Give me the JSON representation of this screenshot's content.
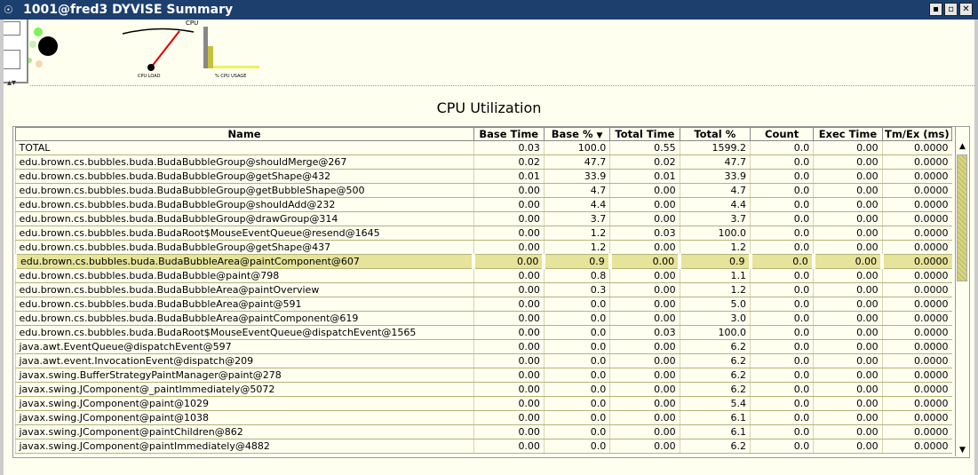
{
  "window": {
    "title": "1001@fred3 DYVISE Summary",
    "buttons": [
      "▪",
      "▫",
      "✕"
    ]
  },
  "gauges": {
    "cpu_label": "CPU",
    "cpu_load_label": "CPU LOAD",
    "cpu_usage_label": "% CPU USAGE"
  },
  "panel": {
    "title": "CPU Utilization"
  },
  "table": {
    "columns": [
      "Name",
      "Base Time",
      "Base %",
      "Total Time",
      "Total %",
      "Count",
      "Exec Time",
      "Tm/Ex (ms)"
    ],
    "sort_indicator": "▼",
    "selected_row": 8,
    "rows": [
      [
        "TOTAL",
        "0.03",
        "100.0",
        "0.55",
        "1599.2",
        "0.0",
        "0.00",
        "0.0000"
      ],
      [
        "edu.brown.cs.bubbles.buda.BudaBubbleGroup@shouldMerge@267",
        "0.02",
        "47.7",
        "0.02",
        "47.7",
        "0.0",
        "0.00",
        "0.0000"
      ],
      [
        "edu.brown.cs.bubbles.buda.BudaBubbleGroup@getShape@432",
        "0.01",
        "33.9",
        "0.01",
        "33.9",
        "0.0",
        "0.00",
        "0.0000"
      ],
      [
        "edu.brown.cs.bubbles.buda.BudaBubbleGroup@getBubbleShape@500",
        "0.00",
        "4.7",
        "0.00",
        "4.7",
        "0.0",
        "0.00",
        "0.0000"
      ],
      [
        "edu.brown.cs.bubbles.buda.BudaBubbleGroup@shouldAdd@232",
        "0.00",
        "4.4",
        "0.00",
        "4.4",
        "0.0",
        "0.00",
        "0.0000"
      ],
      [
        "edu.brown.cs.bubbles.buda.BudaBubbleGroup@drawGroup@314",
        "0.00",
        "3.7",
        "0.00",
        "3.7",
        "0.0",
        "0.00",
        "0.0000"
      ],
      [
        "edu.brown.cs.bubbles.buda.BudaRoot$MouseEventQueue@resend@1645",
        "0.00",
        "1.2",
        "0.03",
        "100.0",
        "0.0",
        "0.00",
        "0.0000"
      ],
      [
        "edu.brown.cs.bubbles.buda.BudaBubbleGroup@getShape@437",
        "0.00",
        "1.2",
        "0.00",
        "1.2",
        "0.0",
        "0.00",
        "0.0000"
      ],
      [
        "edu.brown.cs.bubbles.buda.BudaBubbleArea@paintComponent@607",
        "0.00",
        "0.9",
        "0.00",
        "0.9",
        "0.0",
        "0.00",
        "0.0000"
      ],
      [
        "edu.brown.cs.bubbles.buda.BudaBubble@paint@798",
        "0.00",
        "0.8",
        "0.00",
        "1.1",
        "0.0",
        "0.00",
        "0.0000"
      ],
      [
        "edu.brown.cs.bubbles.buda.BudaBubbleArea@paintOverview",
        "0.00",
        "0.3",
        "0.00",
        "1.2",
        "0.0",
        "0.00",
        "0.0000"
      ],
      [
        "edu.brown.cs.bubbles.buda.BudaBubbleArea@paint@591",
        "0.00",
        "0.0",
        "0.00",
        "5.0",
        "0.0",
        "0.00",
        "0.0000"
      ],
      [
        "edu.brown.cs.bubbles.buda.BudaBubbleArea@paintComponent@619",
        "0.00",
        "0.0",
        "0.00",
        "3.0",
        "0.0",
        "0.00",
        "0.0000"
      ],
      [
        "edu.brown.cs.bubbles.buda.BudaRoot$MouseEventQueue@dispatchEvent@1565",
        "0.00",
        "0.0",
        "0.03",
        "100.0",
        "0.0",
        "0.00",
        "0.0000"
      ],
      [
        "java.awt.EventQueue@dispatchEvent@597",
        "0.00",
        "0.0",
        "0.00",
        "6.2",
        "0.0",
        "0.00",
        "0.0000"
      ],
      [
        "java.awt.event.InvocationEvent@dispatch@209",
        "0.00",
        "0.0",
        "0.00",
        "6.2",
        "0.0",
        "0.00",
        "0.0000"
      ],
      [
        "javax.swing.BufferStrategyPaintManager@paint@278",
        "0.00",
        "0.0",
        "0.00",
        "6.2",
        "0.0",
        "0.00",
        "0.0000"
      ],
      [
        "javax.swing.JComponent@_paintImmediately@5072",
        "0.00",
        "0.0",
        "0.00",
        "6.2",
        "0.0",
        "0.00",
        "0.0000"
      ],
      [
        "javax.swing.JComponent@paint@1029",
        "0.00",
        "0.0",
        "0.00",
        "5.4",
        "0.0",
        "0.00",
        "0.0000"
      ],
      [
        "javax.swing.JComponent@paint@1038",
        "0.00",
        "0.0",
        "0.00",
        "6.1",
        "0.0",
        "0.00",
        "0.0000"
      ],
      [
        "javax.swing.JComponent@paintChildren@862",
        "0.00",
        "0.0",
        "0.00",
        "6.1",
        "0.0",
        "0.00",
        "0.0000"
      ],
      [
        "javax.swing.JComponent@paintImmediately@4882",
        "0.00",
        "0.0",
        "0.00",
        "6.2",
        "0.0",
        "0.00",
        "0.0000"
      ]
    ]
  },
  "scrollbar": {
    "up_icon": "▲",
    "down_icon": "▼"
  }
}
